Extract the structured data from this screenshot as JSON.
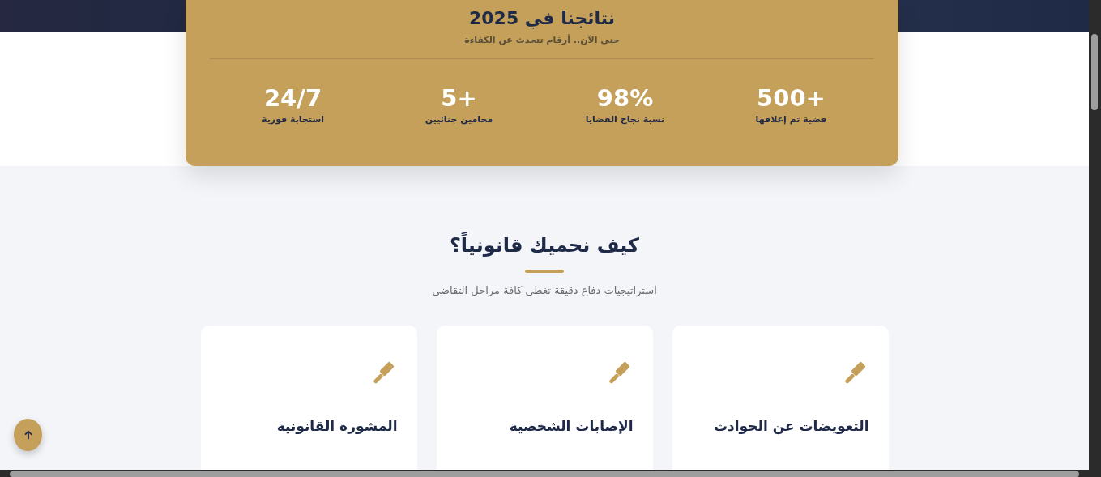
{
  "stats": {
    "title": "نتائجنا في 2025",
    "subtitle": "حتى الآن.. أرقام تتحدث عن الكفاءة",
    "items": [
      {
        "value": "500+",
        "label": "قضية تم إغلاقها"
      },
      {
        "value": "98%",
        "label": "نسبة نجاح القضايا"
      },
      {
        "value": "5+",
        "label": "محامين جنائيين"
      },
      {
        "value": "24/7",
        "label": "استجابة فورية"
      }
    ]
  },
  "services": {
    "title": "كيف نحميك قانونياً؟",
    "subtitle": "استراتيجيات دفاع دقيقة تغطي كافة مراحل التقاضي",
    "cards": [
      {
        "title": "التعويضات عن الحوادث"
      },
      {
        "title": "الإصابات الشخصية"
      },
      {
        "title": "المشورة القانونية"
      }
    ]
  }
}
